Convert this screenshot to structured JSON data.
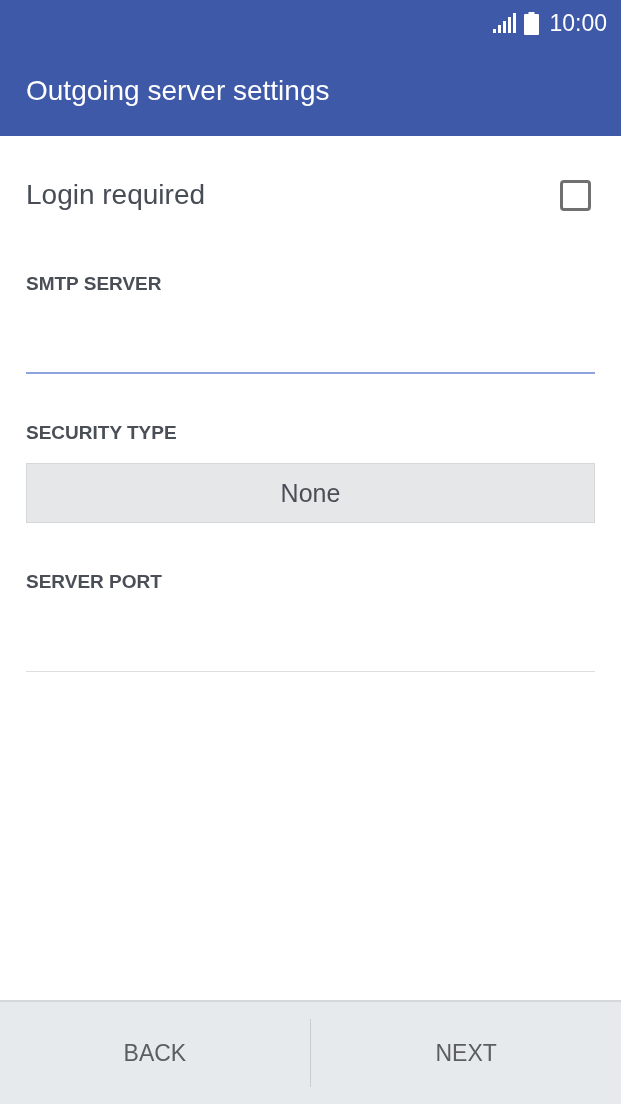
{
  "status_bar": {
    "time": "10:00"
  },
  "app_bar": {
    "title": "Outgoing server settings"
  },
  "login_required": {
    "label": "Login required",
    "checked": false
  },
  "fields": [
    {
      "kind": "text",
      "label": "SMTP SERVER",
      "focused": true
    },
    {
      "kind": "dropdown",
      "label": "SECURITY TYPE",
      "value": "None"
    },
    {
      "kind": "text",
      "label": "SERVER PORT",
      "focused": false
    }
  ],
  "buttons": [
    {
      "label": "BACK"
    },
    {
      "label": "NEXT"
    }
  ]
}
